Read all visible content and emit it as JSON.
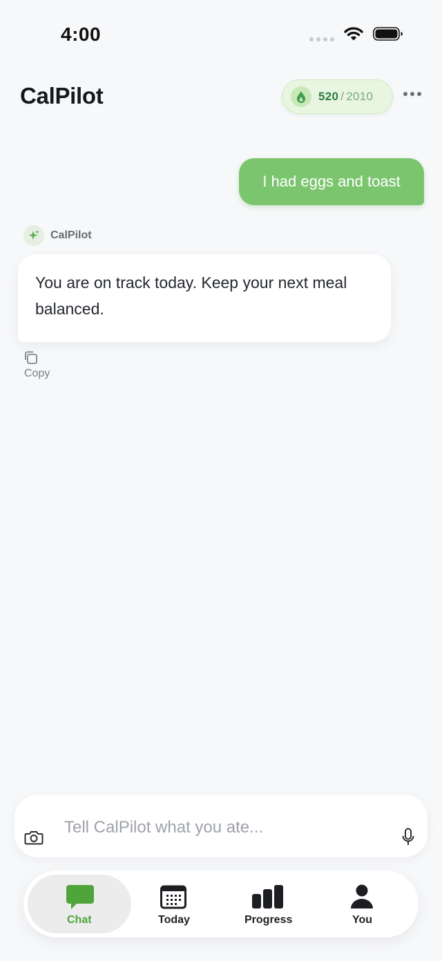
{
  "status_bar": {
    "time": "4:00"
  },
  "header": {
    "title": "CalPilot",
    "calories_current": "520",
    "calories_separator": "/",
    "calories_goal": "2010"
  },
  "messages": {
    "user_text": "I had eggs and toast",
    "assistant_name": "CalPilot",
    "assistant_text": "You are on track today. Keep your next meal balanced.",
    "copy_label": "Copy"
  },
  "input": {
    "placeholder": "Tell CalPilot what you ate..."
  },
  "tabs": [
    {
      "label": "Chat",
      "icon": "chat-bubble-icon",
      "active": true
    },
    {
      "label": "Today",
      "icon": "calendar-icon",
      "active": false
    },
    {
      "label": "Progress",
      "icon": "bar-chart-icon",
      "active": false
    },
    {
      "label": "You",
      "icon": "person-icon",
      "active": false
    }
  ],
  "colors": {
    "accent_green": "#7cc56f",
    "active_tab_green": "#4ea53c",
    "pill_background": "#e8f5e1",
    "calorie_text_green": "#2f7d44"
  }
}
